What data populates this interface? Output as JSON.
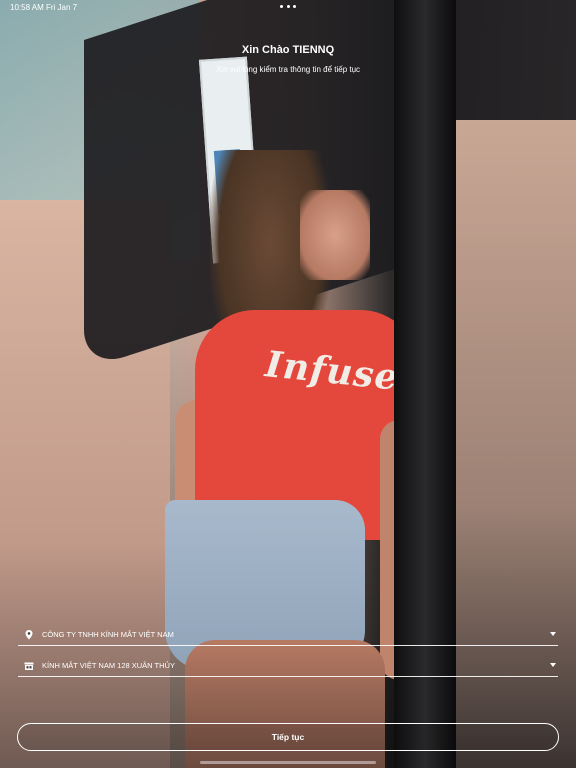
{
  "status_bar": {
    "time": "10:58 AM",
    "date": "Fri Jan 7"
  },
  "header": {
    "title": "Xin Chào TIENNQ",
    "subtitle": "Xin vui lòng kiểm tra thông tin để tiếp tục"
  },
  "background": {
    "shirt_text": "Infuse"
  },
  "form": {
    "company": {
      "icon": "location-pin-icon",
      "value": "CÔNG TY TNHH KÍNH MẮT VIỆT NAM"
    },
    "store": {
      "icon": "store-icon",
      "value": "KÍNH MẮT VIỆT NAM 128 XUÂN THỦY"
    }
  },
  "actions": {
    "continue_label": "Tiếp tục"
  },
  "colors": {
    "text": "#ffffff",
    "shirt": "#e4483d"
  }
}
